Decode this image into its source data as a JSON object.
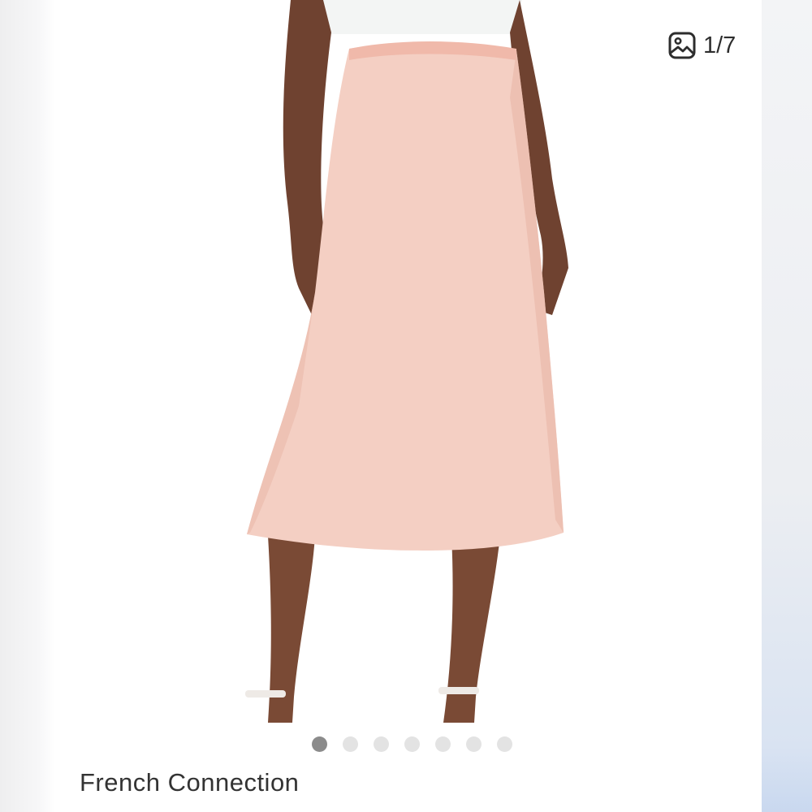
{
  "gallery": {
    "counter_text": "1/7",
    "counter_icon": "image-icon",
    "dot_count": 7,
    "active_index": 0
  },
  "product": {
    "brand": "French Connection"
  },
  "colors": {
    "skirt": "#f4cfc3",
    "skin": "#7a4a35",
    "top": "#f3f5f4",
    "dot_active": "#8b8b8b",
    "dot_inactive": "#e3e3e3"
  }
}
